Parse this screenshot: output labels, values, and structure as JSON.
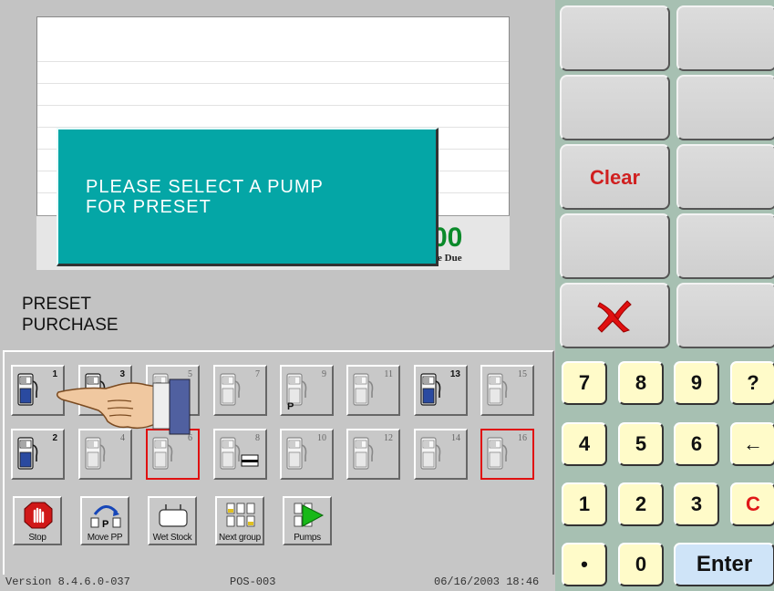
{
  "display": {
    "dialog_message": "PLEASE  SELECT  A  PUMP\nFOR  PRESET",
    "total_value": "00",
    "total_label": "e Due",
    "mode_label": "PRESET\nPURCHASE"
  },
  "pumps_row1": [
    {
      "number": "1",
      "active": true,
      "selected": false,
      "extra": ""
    },
    {
      "number": "3",
      "active": true,
      "selected": false,
      "extra": ""
    },
    {
      "number": "5",
      "active": false,
      "selected": false,
      "extra": ""
    },
    {
      "number": "7",
      "active": false,
      "selected": false,
      "extra": ""
    },
    {
      "number": "9",
      "active": false,
      "selected": false,
      "extra": "P"
    },
    {
      "number": "11",
      "active": false,
      "selected": false,
      "extra": ""
    },
    {
      "number": "13",
      "active": true,
      "selected": false,
      "extra": ""
    },
    {
      "number": "15",
      "active": false,
      "selected": false,
      "extra": ""
    }
  ],
  "pumps_row2": [
    {
      "number": "2",
      "active": true,
      "selected": false,
      "extra": ""
    },
    {
      "number": "4",
      "active": false,
      "selected": false,
      "extra": ""
    },
    {
      "number": "6",
      "active": false,
      "selected": true,
      "extra": ""
    },
    {
      "number": "8",
      "active": false,
      "selected": false,
      "extra": "card"
    },
    {
      "number": "10",
      "active": false,
      "selected": false,
      "extra": ""
    },
    {
      "number": "12",
      "active": false,
      "selected": false,
      "extra": ""
    },
    {
      "number": "14",
      "active": false,
      "selected": false,
      "extra": ""
    },
    {
      "number": "16",
      "active": false,
      "selected": true,
      "extra": ""
    }
  ],
  "functions": {
    "stop": "Stop",
    "move_pp": "Move PP",
    "wet_stock": "Wet Stock",
    "next_group": "Next group",
    "pumps": "Pumps"
  },
  "status_bar": {
    "version": "Version  8.4.6.0-037",
    "terminal": "POS-003",
    "datetime": "06/16/2003 18:46"
  },
  "right_panel": {
    "clear_label": "Clear",
    "cancel_icon": "red-x-icon",
    "keys": [
      "7",
      "8",
      "9",
      "?",
      "4",
      "5",
      "6",
      "←",
      "1",
      "2",
      "3",
      "C",
      "•",
      "0",
      "Enter"
    ]
  },
  "colors": {
    "dialog_bg": "#04A6A6",
    "total_green": "#0A8A2A",
    "clear_red": "#D02020",
    "keypad_yellow": "#FFFBC9",
    "enter_blue": "#CFE4F8",
    "panel_green": "#A7C0B2",
    "selected_border": "#E01010"
  }
}
